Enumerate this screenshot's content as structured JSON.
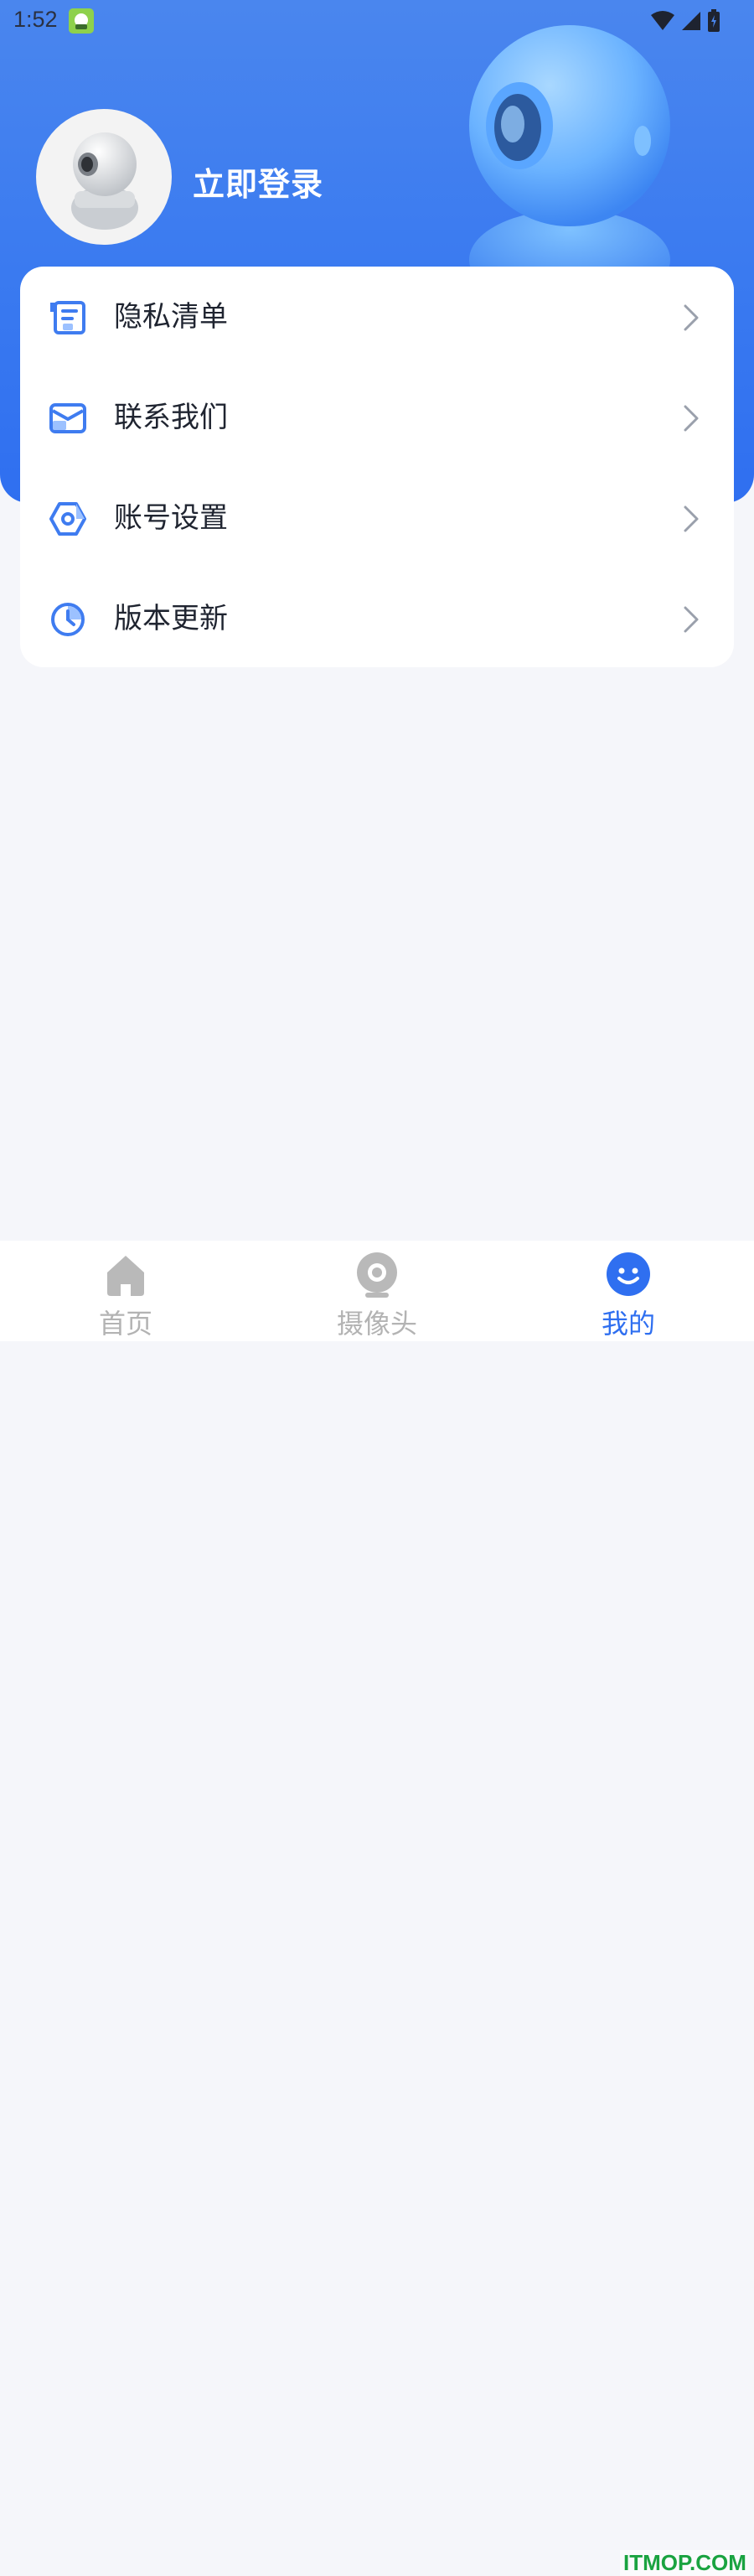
{
  "status_bar": {
    "time": "1:52",
    "icons": [
      "app-icon",
      "wifi-icon",
      "signal-icon",
      "battery-icon"
    ]
  },
  "profile": {
    "login_label": "立即登录"
  },
  "menu": {
    "items": [
      {
        "label": "隐私清单",
        "icon": "privacy-list-icon"
      },
      {
        "label": "联系我们",
        "icon": "mail-icon"
      },
      {
        "label": "账号设置",
        "icon": "settings-icon"
      },
      {
        "label": "版本更新",
        "icon": "update-icon"
      }
    ]
  },
  "bottom_nav": {
    "items": [
      {
        "label": "首页",
        "icon": "home-icon"
      },
      {
        "label": "摄像头",
        "icon": "camera-icon"
      },
      {
        "label": "我的",
        "icon": "smile-icon"
      }
    ],
    "active_index": 2
  },
  "watermark": "ITMOP.COM",
  "colors": {
    "accent": "#2f6ff0",
    "icon_blue": "#3f7cf0",
    "inactive": "#b3b3b3"
  }
}
